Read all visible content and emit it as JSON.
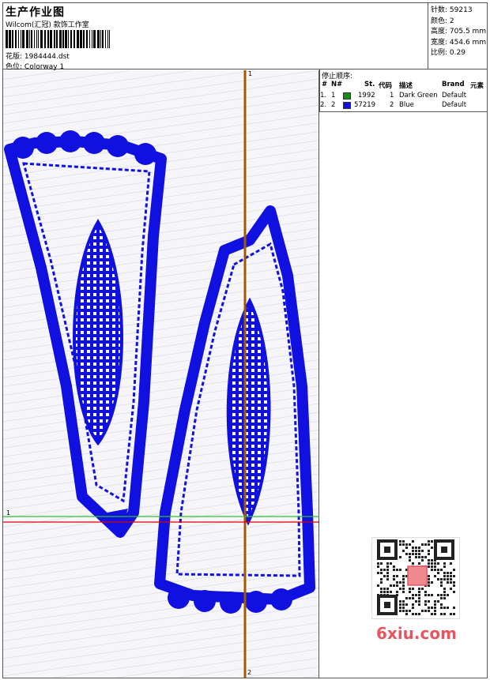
{
  "header": {
    "title": "生产作业图",
    "company": "Wilcom(汇冠) 款饰工作室",
    "file_label": "花版:",
    "file_value": "1984444.dst",
    "colorway_label": "色位:",
    "colorway_value": "Colorway 1"
  },
  "stats": {
    "stitches_label": "针数:",
    "stitches_value": "59213",
    "colors_label": "颜色:",
    "colors_value": "2",
    "height_label": "高度:",
    "height_value": "705.5 mm",
    "width_label": "宽度:",
    "width_value": "454.6 mm",
    "scale_label": "比例:",
    "scale_value": "0.29"
  },
  "stop_sequence": {
    "title": "停止顺序:",
    "headers": {
      "num": "#",
      "n": "N#",
      "st": "St.",
      "code": "代码",
      "desc": "描述",
      "brand": "Brand",
      "elem": "元素"
    },
    "rows": [
      {
        "num": "1.",
        "n": "1",
        "color": "#1a8a1a",
        "st": "1992",
        "code": "1",
        "desc": "Dark Green",
        "brand": "Default"
      },
      {
        "num": "2.",
        "n": "2",
        "color": "#1010e0",
        "st": "57219",
        "code": "2",
        "desc": "Blue",
        "brand": "Default"
      }
    ]
  },
  "axes": {
    "v_top": "1",
    "v_bottom": "2",
    "h_left": "1"
  },
  "colors": {
    "thread_blue": "#1010e0",
    "thread_green": "#1a8a1a",
    "axis_orange": "#a05a00",
    "axis_red": "#e00000",
    "axis_green": "#30c030"
  },
  "watermark": {
    "site": "6xiu.com"
  }
}
